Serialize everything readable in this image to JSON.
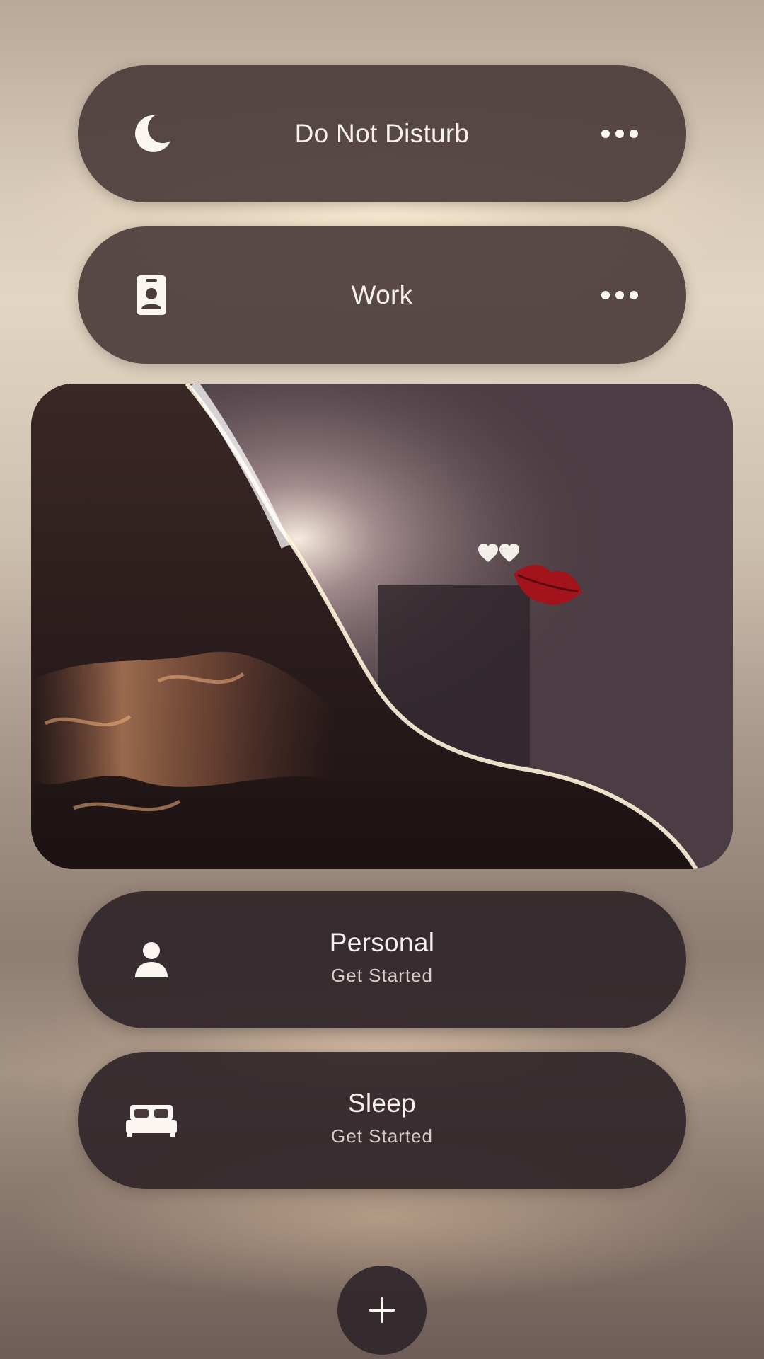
{
  "focus_modes": [
    {
      "title": "Do Not Disturb",
      "icon": "moon-icon",
      "has_more": true
    },
    {
      "title": "Work",
      "icon": "id-badge-icon",
      "has_more": true
    },
    {
      "title": "Personal",
      "subtitle": "Get Started",
      "icon": "person-icon"
    },
    {
      "title": "Sleep",
      "subtitle": "Get Started",
      "icon": "bed-icon"
    }
  ],
  "photo_widget": {
    "description_icons": [
      "hearts-sticker-icon",
      "lips-sticker-icon"
    ]
  },
  "add_button": {
    "icon": "plus-icon"
  },
  "colors": {
    "pill_background": "#483838",
    "text": "#f6f1ee",
    "subtitle_text": "#d6ccc8"
  }
}
